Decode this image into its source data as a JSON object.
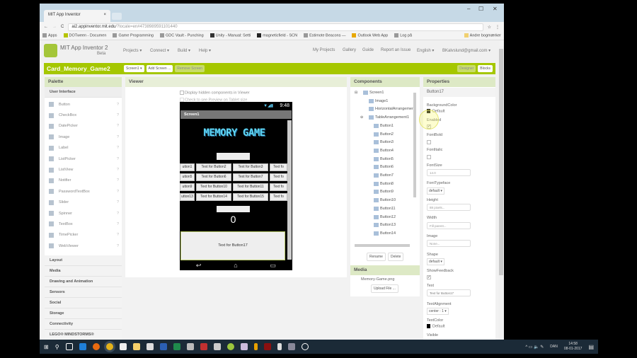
{
  "browser": {
    "tab_title": "MIT App Inventor",
    "url_host": "ai2.appinventor.mit.edu",
    "url_rest": "/?locale=en#4738989591101440",
    "bookmarks": [
      "Apps",
      "DOTween - Documen",
      "Game Programming",
      "GDC Vault - Punching",
      "Unity - Manual: Setti",
      "magneticfield - SCN",
      "Estimote Beacons —",
      "Outlook Web App",
      "Log på"
    ],
    "other_bookmarks": "Andre bogmærker"
  },
  "app": {
    "name": "MIT App Inventor 2",
    "beta": "Beta",
    "menu": [
      "Projects ▾",
      "Connect ▾",
      "Build ▾",
      "Help ▾"
    ],
    "right_links": [
      "My Projects",
      "Gallery",
      "Guide",
      "Report an Issue",
      "English ▾",
      "BKalvslund@gmail.com ▾"
    ]
  },
  "project": {
    "name": "Card_Memory_Game2",
    "screen_select": "Screen1 ▾",
    "add_screen": "Add Screen ...",
    "remove_screen": "Remove Screen",
    "designer": "Designer",
    "blocks": "Blocks"
  },
  "palette": {
    "title": "Palette",
    "category": "User Interface",
    "items": [
      "Button",
      "CheckBox",
      "DatePicker",
      "Image",
      "Label",
      "ListPicker",
      "ListView",
      "Notifier",
      "PasswordTextBox",
      "Slider",
      "Spinner",
      "TextBox",
      "TimePicker",
      "WebViewer"
    ],
    "categories": [
      "Layout",
      "Media",
      "Drawing and Animation",
      "Sensors",
      "Social",
      "Storage",
      "Connectivity",
      "LEGO® MINDSTORMS®"
    ]
  },
  "viewer": {
    "title": "Viewer",
    "opt_hidden": "Display hidden components in Viewer",
    "opt_tablet": "Check to see Preview on Tablet size",
    "phone": {
      "time": "9:48",
      "screen_title": "Screen1",
      "banner": "MEMORY GAME",
      "grid": [
        [
          "utton1",
          "Text for Button2",
          "Text for Button3",
          "Text fo"
        ],
        [
          "utton5",
          "Text for Button6",
          "Text for Button7",
          "Text fo"
        ],
        [
          "utton9",
          "Text for Button10",
          "Text for Button11",
          "Text fo"
        ],
        [
          "utton13",
          "Text for Button14",
          "Text for Button15",
          "Text fo"
        ]
      ],
      "score": "0",
      "bottom_button": "Text for Button17"
    }
  },
  "components": {
    "title": "Components",
    "tree": [
      "Screen1",
      "Image1",
      "HorizontalArrangemer",
      "TableArrangement1",
      "Button1",
      "Button2",
      "Button3",
      "Button4",
      "Button5",
      "Button6",
      "Button7",
      "Button8",
      "Button9",
      "Button10",
      "Button11",
      "Button12",
      "Button13",
      "Button14"
    ],
    "rename": "Rename",
    "delete": "Delete"
  },
  "media": {
    "title": "Media",
    "file": "Memory-Game.png",
    "upload": "Upload File ..."
  },
  "properties": {
    "title": "Properties",
    "component": "Button17",
    "background_color_label": "BackgroundColor",
    "background_color": "Default",
    "enabled_label": "Enabled",
    "fontbold_label": "FontBold",
    "fontitalic_label": "FontItalic",
    "fontsize_label": "FontSize",
    "fontsize": "14.0",
    "typeface_label": "FontTypeface",
    "typeface": "default ▾",
    "height_label": "Height",
    "height": "88 pixels...",
    "width_label": "Width",
    "width": "Fill parent...",
    "image_label": "Image",
    "image": "None...",
    "shape_label": "Shape",
    "shape": "default ▾",
    "showfeedback_label": "ShowFeedback",
    "text_label": "Text",
    "text": "Text for Button17",
    "align_label": "TextAlignment",
    "align": "center : 1 ▾",
    "textcolor_label": "TextColor",
    "textcolor": "Default",
    "visible_label": "Visible"
  },
  "taskbar": {
    "lang": "DAN",
    "time": "14:58",
    "date": "08-01-2017"
  },
  "colors": {
    "green": "#a5c700",
    "panel_header": "#dde9c5",
    "taskbar": "#1b2a37"
  }
}
